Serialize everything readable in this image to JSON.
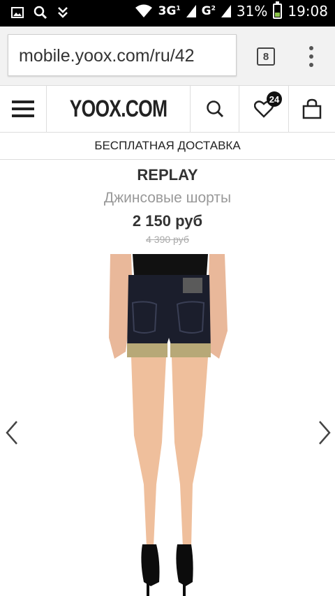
{
  "status_bar": {
    "network_1": "3G",
    "network_1_sup": "1",
    "network_2": "G",
    "network_2_sup": "2",
    "battery": "31%",
    "battery_level": 0.31,
    "time": "19:08",
    "icons": [
      "gallery-icon",
      "search-icon",
      "download-icon",
      "wifi-icon",
      "signal-icon",
      "signal-icon",
      "battery-icon"
    ]
  },
  "browser": {
    "url": "mobile.yoox.com/ru/42",
    "tab_count": "8"
  },
  "header": {
    "logo": "YOOX.COM",
    "wishlist_count": "24",
    "icons": [
      "hamburger-menu-icon",
      "search-icon",
      "heart-icon",
      "shopping-bag-icon"
    ]
  },
  "shipping_banner": "БЕСПЛАТНАЯ ДОСТАВКА",
  "product": {
    "brand": "REPLAY",
    "title": "Джинсовые шорты",
    "price": "2 150 руб",
    "old_price": "4 390 руб"
  },
  "colors": {
    "status_bar": "#000000",
    "battery_fill": "#8bc34a",
    "text_dark": "#333333",
    "text_muted": "#999999"
  }
}
